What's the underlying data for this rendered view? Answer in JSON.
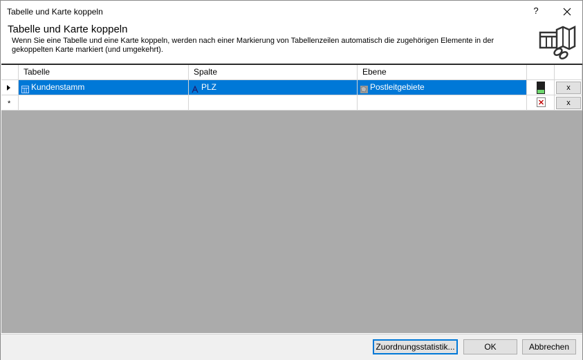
{
  "window": {
    "title": "Tabelle und Karte koppeln",
    "help_label": "?"
  },
  "header": {
    "title": "Tabelle und Karte koppeln",
    "description": "Wenn Sie eine Tabelle und eine Karte koppeln, werden nach einer Markierung von Tabellenzeilen automatisch die zugehörigen Elemente in der gekoppelten Karte markiert (und umgekehrt).",
    "icon": "table-map-link-icon"
  },
  "grid": {
    "columns": [
      "Tabelle",
      "Spalte",
      "Ebene",
      "",
      ""
    ],
    "rows": [
      {
        "tabelle": "Kundenstamm",
        "tabelle_icon": "table-icon",
        "spalte": "PLZ",
        "spalte_icon": "text-column-icon",
        "ebene": "Postleitgebiete",
        "ebene_icon": "map-layer-icon",
        "color": "#1f1f1f",
        "color_accent": "#6fd86f",
        "delete_label": "x",
        "selected": true
      },
      {
        "tabelle": "",
        "spalte": "",
        "ebene": "",
        "delete_label": "x",
        "new_row_marker": "*",
        "selected": false
      }
    ]
  },
  "footer": {
    "stat_label": "Zuordnungsstatistik...",
    "ok_label": "OK",
    "cancel_label": "Abbrechen"
  },
  "colors": {
    "selection": "#0078d7",
    "grid_background": "#ababab",
    "button_face": "#e1e1e1"
  }
}
